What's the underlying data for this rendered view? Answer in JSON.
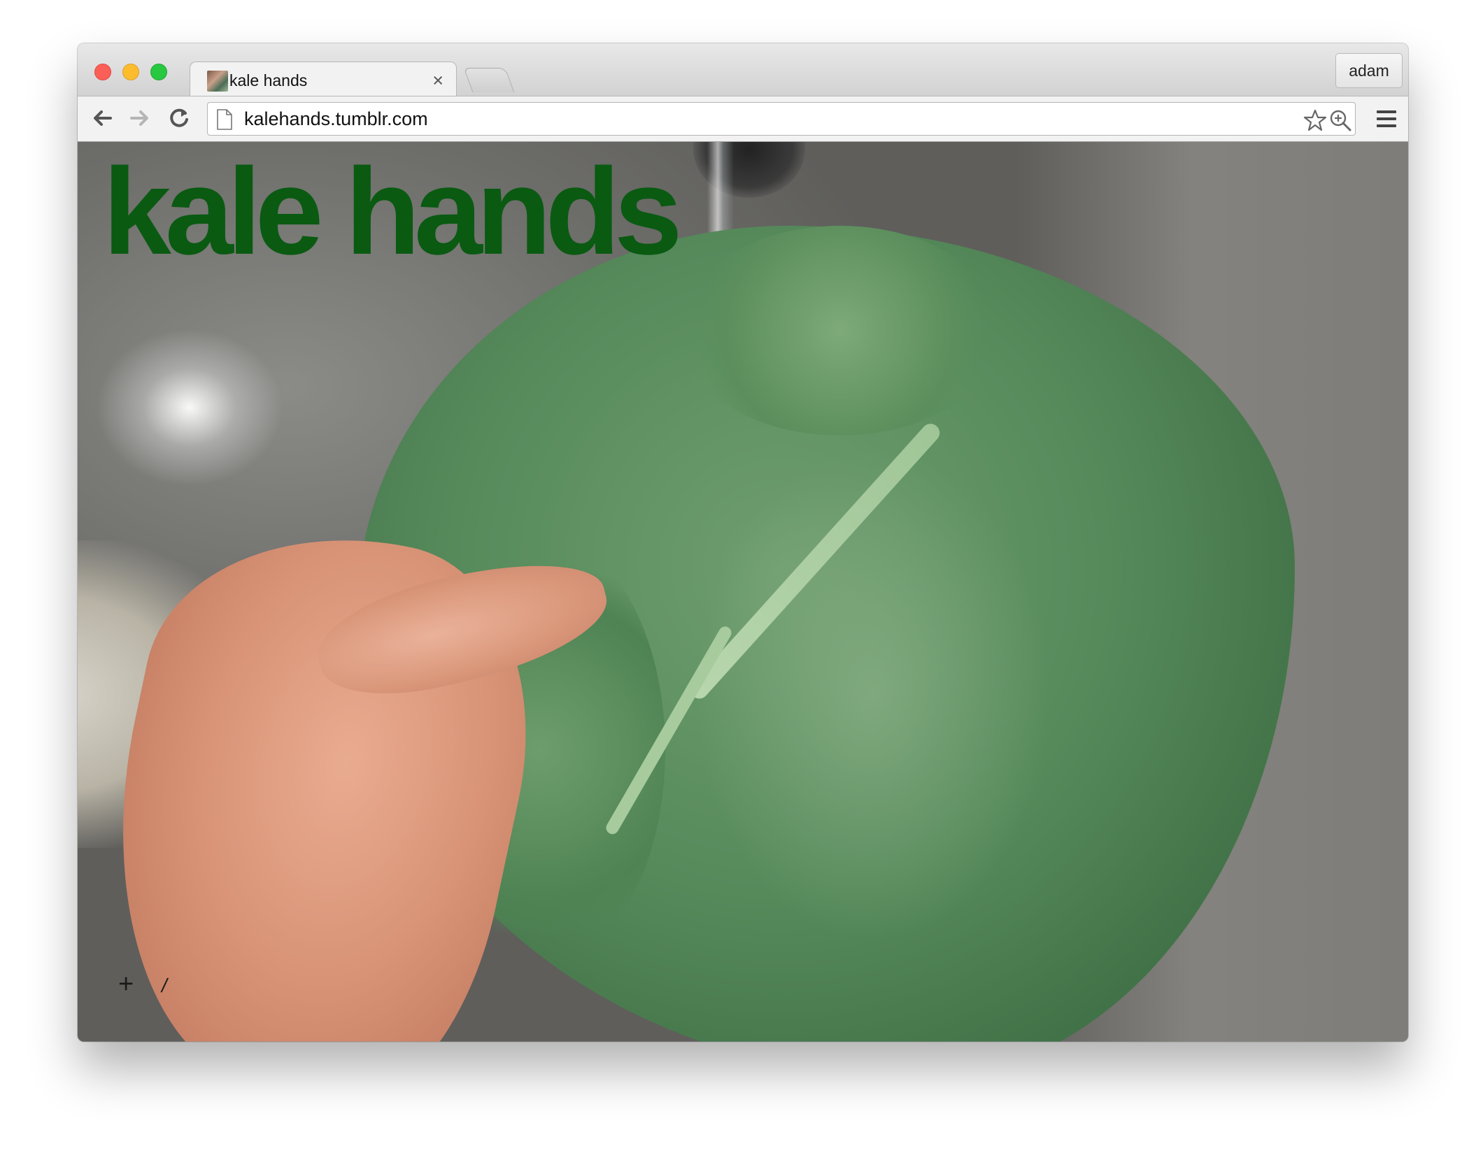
{
  "browser": {
    "tab": {
      "title": "kale hands",
      "close_glyph": "×"
    },
    "profile_label": "adam",
    "url": "kalehands.tumblr.com",
    "icons": {
      "back": "back-arrow-icon",
      "forward": "forward-arrow-icon",
      "reload": "reload-icon",
      "page": "page-icon",
      "bookmark": "star-icon",
      "zoom": "zoom-icon",
      "menu": "hamburger-menu-icon"
    }
  },
  "page": {
    "title": "kale hands",
    "title_color": "#0a5a12",
    "controls": {
      "plus": "+",
      "slash": "/"
    }
  }
}
